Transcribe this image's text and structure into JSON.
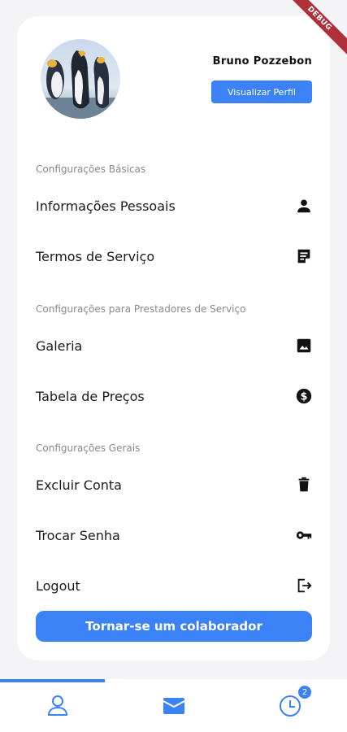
{
  "debug_banner": "DEBUG",
  "profile": {
    "name": "Bruno Pozzebon",
    "view_button": "Visualizar Perfil"
  },
  "sections": {
    "basic": "Configurações Básicas",
    "providers": "Configurações para Prestadores de Serviço",
    "general": "Configurações Gerais"
  },
  "menu": {
    "personal_info": "Informações Pessoais",
    "terms": "Termos de Serviço",
    "gallery": "Galeria",
    "prices": "Tabela de Preços",
    "delete_account": "Excluir Conta",
    "change_password": "Trocar Senha",
    "logout": "Logout"
  },
  "cta_label": "Tornar-se um colaborador",
  "bottom_nav": {
    "active_tab": "profile",
    "history_badge": "2"
  },
  "colors": {
    "accent": "#3b82f6",
    "debug": "#b0303a"
  }
}
